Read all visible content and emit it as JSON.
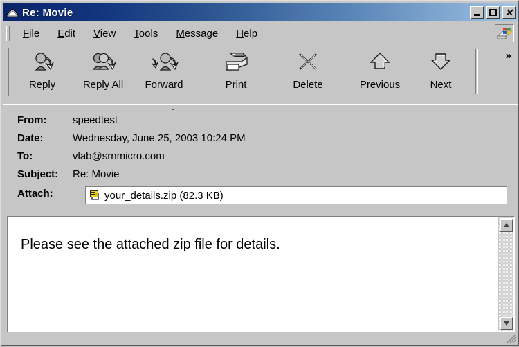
{
  "window": {
    "title": "Re: Movie",
    "icon": "envelope-icon",
    "controls": [
      {
        "name": "minimize",
        "glyph": "_"
      },
      {
        "name": "maximize",
        "glyph": "□"
      },
      {
        "name": "close",
        "glyph": "✕"
      }
    ],
    "titlebar_color_start": "#0a246a",
    "titlebar_color_end": "#a6c6e4",
    "face_color": "#c6c6c6"
  },
  "menubar": {
    "items": [
      {
        "label": "File",
        "mnemonic": "F"
      },
      {
        "label": "Edit",
        "mnemonic": "E"
      },
      {
        "label": "View",
        "mnemonic": "V"
      },
      {
        "label": "Tools",
        "mnemonic": "T"
      },
      {
        "label": "Message",
        "mnemonic": "M"
      },
      {
        "label": "Help",
        "mnemonic": "H"
      }
    ],
    "logo_icon": "outlook-express-logo-icon"
  },
  "toolbar": {
    "buttons": [
      {
        "label": "Reply",
        "icon": "reply-icon"
      },
      {
        "label": "Reply All",
        "icon": "reply-all-icon"
      },
      {
        "label": "Forward",
        "icon": "forward-icon"
      },
      {
        "label": "Print",
        "icon": "printer-icon"
      },
      {
        "label": "Delete",
        "icon": "delete-x-icon"
      },
      {
        "label": "Previous",
        "icon": "arrow-up-icon"
      },
      {
        "label": "Next",
        "icon": "arrow-down-icon"
      }
    ],
    "overflow_label": "»"
  },
  "headers": {
    "from": {
      "label": "From:",
      "value": "speedtest"
    },
    "date": {
      "label": "Date:",
      "value": "Wednesday, June 25, 2003 10:24 PM"
    },
    "to": {
      "label": "To:",
      "value": "vlab@srnmicro.com"
    },
    "subject": {
      "label": "Subject:",
      "value": "Re: Movie"
    },
    "attach": {
      "label": "Attach:",
      "filename": "your_details.zip (82.3 KB)",
      "icon": "zip-file-icon"
    }
  },
  "body": {
    "text": "Please see the attached zip file for details."
  },
  "scrollbar": {
    "up_icon": "scroll-up-arrow-icon",
    "down_icon": "scroll-down-arrow-icon"
  }
}
